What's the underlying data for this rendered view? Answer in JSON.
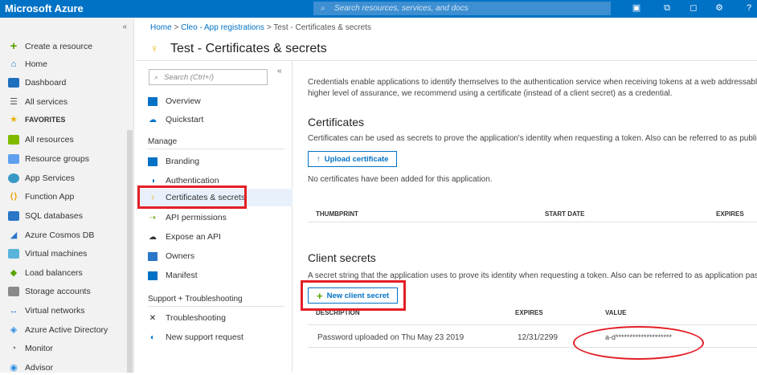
{
  "topbar": {
    "brand": "Microsoft Azure",
    "search_placeholder": "Search resources, services, and docs",
    "icons": [
      "cloud-shell-icon",
      "directory-filter-icon",
      "notifications-icon",
      "settings-icon",
      "help-icon"
    ]
  },
  "leftnav": {
    "collapse_glyph": "«",
    "items": [
      {
        "label": "Create a resource",
        "icon": "plus-icon"
      },
      {
        "label": "Home",
        "icon": "home-icon"
      },
      {
        "label": "Dashboard",
        "icon": "dashboard-icon"
      },
      {
        "label": "All services",
        "icon": "list-icon"
      },
      {
        "label": "FAVORITES",
        "icon": "star-icon"
      },
      {
        "label": "All resources",
        "icon": "grid-icon"
      },
      {
        "label": "Resource groups",
        "icon": "resource-group-icon"
      },
      {
        "label": "App Services",
        "icon": "app-services-icon"
      },
      {
        "label": "Function App",
        "icon": "function-app-icon"
      },
      {
        "label": "SQL databases",
        "icon": "sql-icon"
      },
      {
        "label": "Azure Cosmos DB",
        "icon": "cosmos-icon"
      },
      {
        "label": "Virtual machines",
        "icon": "vm-icon"
      },
      {
        "label": "Load balancers",
        "icon": "load-balancer-icon"
      },
      {
        "label": "Storage accounts",
        "icon": "storage-icon"
      },
      {
        "label": "Virtual networks",
        "icon": "vnet-icon"
      },
      {
        "label": "Azure Active Directory",
        "icon": "aad-icon"
      },
      {
        "label": "Monitor",
        "icon": "monitor-icon"
      },
      {
        "label": "Advisor",
        "icon": "advisor-icon"
      }
    ]
  },
  "breadcrumb": {
    "home": "Home",
    "sep": ">",
    "app_registrations": "Cleo - App registrations",
    "current": "Test - Certificates & secrets"
  },
  "page_title": "Test - Certificates & secrets",
  "menu": {
    "search_placeholder": "Search (Ctrl+/)",
    "collapse_glyph": "«",
    "overview": "Overview",
    "quickstart": "Quickstart",
    "manage_header": "Manage",
    "manage_items": [
      "Branding",
      "Authentication",
      "Certificates & secrets",
      "API permissions",
      "Expose an API",
      "Owners",
      "Manifest"
    ],
    "support_header": "Support + Troubleshooting",
    "support_items": [
      "Troubleshooting",
      "New support request"
    ]
  },
  "content": {
    "intro_line1": "Credentials enable applications to identify themselves to the authentication service when receiving tokens at a web addressable loca",
    "intro_line2": "higher level of assurance, we recommend using a certificate (instead of a client secret) as a credential.",
    "certificates_title": "Certificates",
    "certificates_desc": "Certificates can be used as secrets to prove the application's identity when requesting a token. Also can be referred to as public keys",
    "upload_button": "Upload certificate",
    "no_certs": "No certificates have been added for this application.",
    "cert_headers": [
      "THUMBPRINT",
      "START DATE",
      "EXPIRES"
    ],
    "secrets_title": "Client secrets",
    "secrets_desc": "A secret string that the application uses to prove its identity when requesting a token. Also can be referred to as application passwo",
    "new_secret_button": "New client secret",
    "secret_headers": [
      "DESCRIPTION",
      "EXPIRES",
      "VALUE"
    ],
    "secret_rows": [
      {
        "description": "Password uploaded on Thu May 23 2019",
        "expires": "12/31/2299",
        "value": "a-d********************"
      }
    ]
  },
  "colors": {
    "azure_blue": "#0072c6",
    "highlight_red": "#e41e26",
    "key_gold": "#e8b000",
    "plus_green": "#57a300"
  }
}
